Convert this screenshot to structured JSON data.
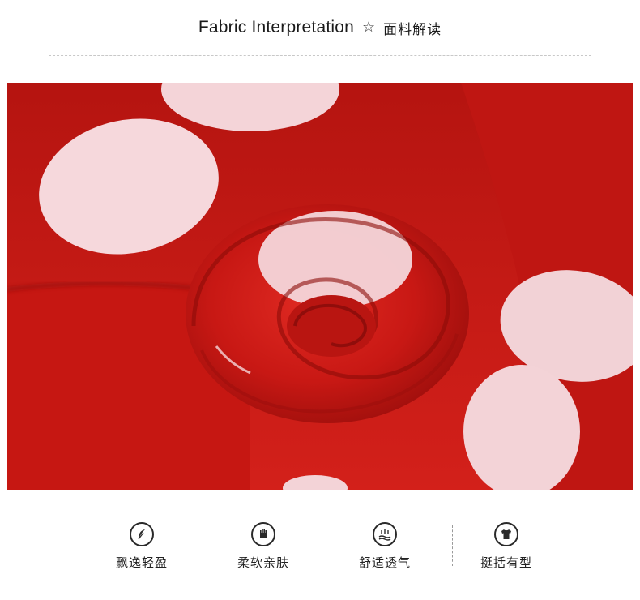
{
  "header": {
    "title_en": "Fabric Interpretation",
    "star_icon": "star-outline-icon",
    "title_cn": "面料解读"
  },
  "photo": {
    "subject": "red-polka-dot-fabric-swirl",
    "colors": {
      "fabric": "#c81814",
      "dot": "#f6d8dc"
    }
  },
  "features": [
    {
      "icon": "feather-icon",
      "label": "飘逸轻盈"
    },
    {
      "icon": "glove-icon",
      "label": "柔软亲肤"
    },
    {
      "icon": "breathable-icon",
      "label": "舒适透气"
    },
    {
      "icon": "tshirt-icon",
      "label": "挺括有型"
    }
  ]
}
